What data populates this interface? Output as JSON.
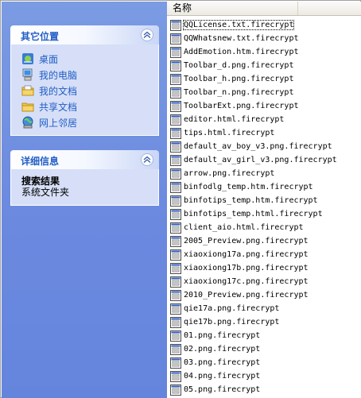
{
  "other_places": {
    "title": "其它位置",
    "items": [
      {
        "label": "桌面",
        "icon": "desktop-icon"
      },
      {
        "label": "我的电脑",
        "icon": "my-computer-icon"
      },
      {
        "label": "我的文档",
        "icon": "my-documents-icon"
      },
      {
        "label": "共享文档",
        "icon": "shared-folder-icon"
      },
      {
        "label": "网上邻居",
        "icon": "network-places-icon"
      }
    ]
  },
  "details": {
    "title": "详细信息",
    "name": "搜索结果",
    "type": "系统文件夹"
  },
  "file_list": {
    "column_name": "名称",
    "files": [
      "QQLicense.txt.firecrypt",
      "QQWhatsnew.txt.firecrypt",
      "AddEmotion.htm.firecrypt",
      "Toolbar_d.png.firecrypt",
      "Toolbar_h.png.firecrypt",
      "Toolbar_n.png.firecrypt",
      "ToolbarExt.png.firecrypt",
      "editor.html.firecrypt",
      "tips.html.firecrypt",
      "default_av_boy_v3.png.firecrypt",
      "default_av_girl_v3.png.firecrypt",
      "arrow.png.firecrypt",
      "binfodlg_temp.htm.firecrypt",
      "binfotips_temp.htm.firecrypt",
      "binfotips_temp.html.firecrypt",
      "client_aio.html.firecrypt",
      "2005_Preview.png.firecrypt",
      "xiaoxiong17a.png.firecrypt",
      "xiaoxiong17b.png.firecrypt",
      "xiaoxiong17c.png.firecrypt",
      "2010_Preview.png.firecrypt",
      "qie17a.png.firecrypt",
      "qie17b.png.firecrypt",
      "01.png.firecrypt",
      "02.png.firecrypt",
      "03.png.firecrypt",
      "04.png.firecrypt",
      "05.png.firecrypt"
    ]
  },
  "colors": {
    "pane_gradient_top": "#7b9be3",
    "pane_gradient_bottom": "#6585dd",
    "panel_title": "#215dc6",
    "panel_body": "#d6dff7"
  }
}
